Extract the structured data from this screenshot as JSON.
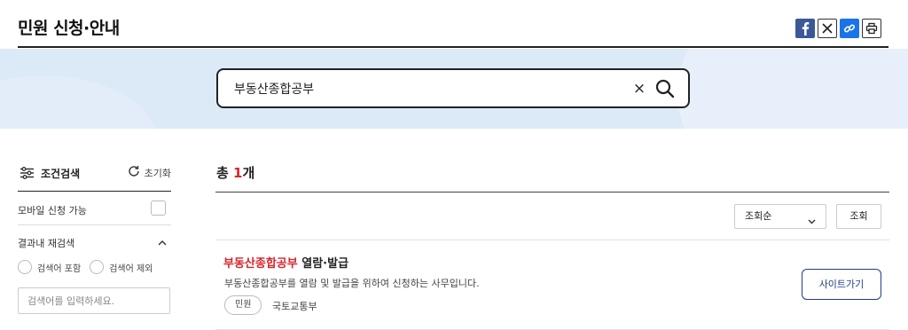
{
  "header": {
    "title": "민원 신청·안내",
    "share": {
      "facebook_icon": "facebook-icon",
      "x_icon": "x-icon",
      "link_icon": "link-icon",
      "print_icon": "print-icon"
    }
  },
  "search": {
    "value": "부동산종합공부",
    "clear_label": "×",
    "search_icon": "search-icon"
  },
  "filter": {
    "title": "조건검색",
    "reset_label": "초기화",
    "mobile_label": "모바일 신청 가능",
    "mobile_checked": false,
    "research_title": "결과내 재검색",
    "radio_include": "검색어 포함",
    "radio_exclude": "검색어 제외",
    "research_placeholder": "검색어를 입력하세요."
  },
  "results": {
    "count_prefix": "총 ",
    "count_value": "1",
    "count_suffix": "개",
    "sort_selected": "조회순",
    "sort_button": "조회",
    "items": [
      {
        "title_highlight": "부동산종합공부",
        "title_rest": " 열람·발급",
        "description": "부동산종합공부를 열람 및 발급을 위하여 신청하는 사무입니다.",
        "tag": "민원",
        "organization": "국토교통부",
        "site_button": "사이트가기"
      }
    ]
  },
  "colors": {
    "accent_red": "#d8262d",
    "navy": "#1f3e85",
    "banner_blue": "#dce9f7"
  }
}
